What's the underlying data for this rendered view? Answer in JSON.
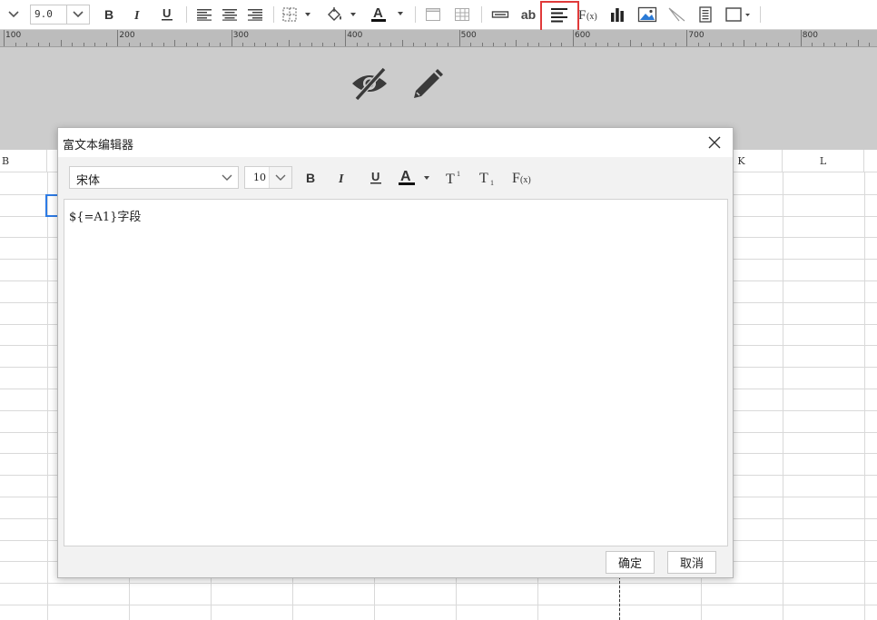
{
  "toolbar": {
    "font_size_value": "9.0",
    "text_button_label": "ab"
  },
  "ruler": {
    "labels": [
      "100",
      "200",
      "300",
      "400",
      "500",
      "600",
      "700",
      "800"
    ]
  },
  "sheet": {
    "column_headers": [
      "B",
      "K",
      "L"
    ]
  },
  "dialog": {
    "title": "富文本编辑器",
    "font_family_value": "宋体",
    "font_size_value": "10",
    "content": "${=A1}字段",
    "ok_label": "确定",
    "cancel_label": "取消"
  },
  "colors": {
    "highlight": "#e03a3a",
    "selection": "#2d7be5",
    "band": "#cccccc",
    "ruler": "#bcbcbc"
  }
}
